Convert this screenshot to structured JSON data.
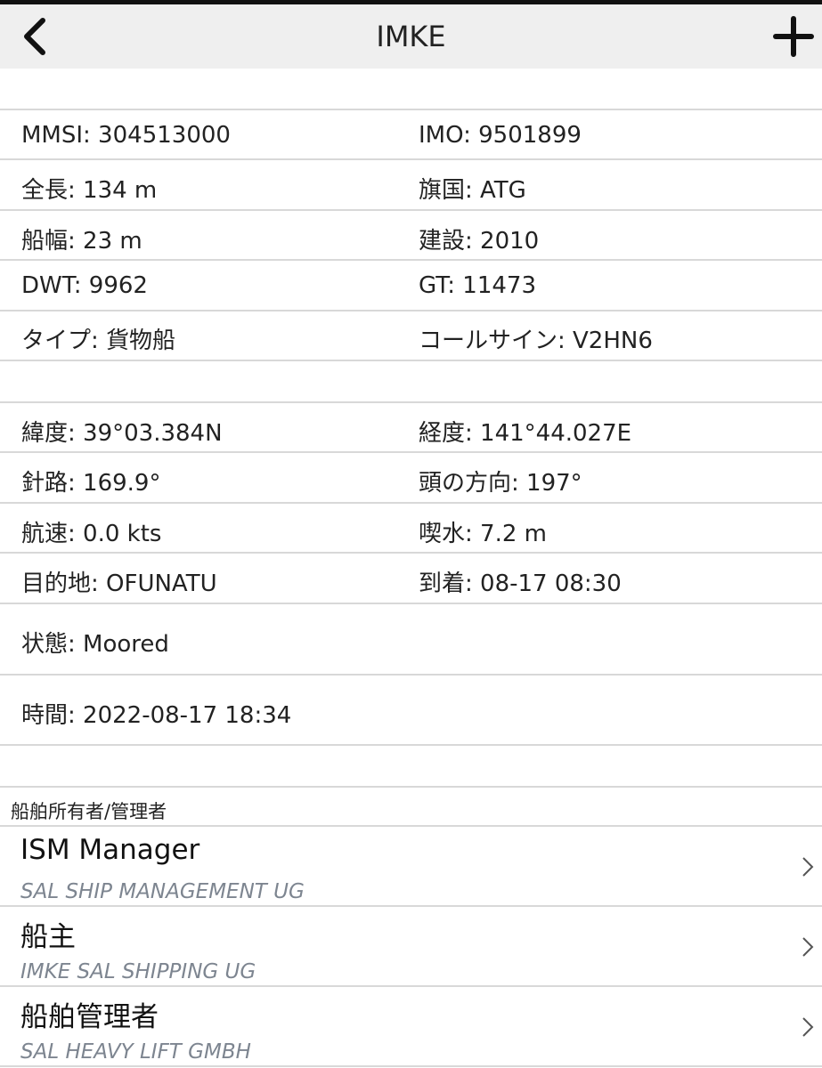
{
  "header": {
    "title": "IMKE",
    "back_icon": "chevron-left-icon",
    "add_icon": "plus-icon"
  },
  "vessel_info": {
    "rows": [
      {
        "left": "MMSI: 304513000",
        "right": "IMO: 9501899"
      },
      {
        "left": "全長: 134 m",
        "right": "旗国: ATG"
      },
      {
        "left": "船幅: 23 m",
        "right": "建設: 2010"
      },
      {
        "left": "DWT: 9962",
        "right": "GT: 11473"
      },
      {
        "left": "タイプ: 貨物船",
        "right": "コールサイン: V2HN6"
      }
    ]
  },
  "voyage_info": {
    "rows": [
      {
        "left": "緯度: 39°03.384N",
        "right": "経度: 141°44.027E"
      },
      {
        "left": "針路: 169.9°",
        "right": "頭の方向: 197°"
      },
      {
        "left": "航速: 0.0 kts",
        "right": "喫水: 7.2 m"
      },
      {
        "left": "目的地: OFUNATU",
        "right": "到着: 08-17 08:30"
      }
    ],
    "status": "状態: Moored",
    "time": "時間: 2022-08-17 18:34"
  },
  "owners": {
    "caption": "船舶所有者/管理者",
    "items": [
      {
        "title": "ISM Manager",
        "subtitle": "SAL SHIP MANAGEMENT UG"
      },
      {
        "title": "船主",
        "subtitle": "IMKE SAL SHIPPING UG"
      },
      {
        "title": "船舶管理者",
        "subtitle": "SAL HEAVY LIFT GMBH"
      }
    ],
    "chevron_icon": "chevron-right-icon"
  },
  "colors": {
    "header_bg": "#efefef",
    "divider": "#d8d8d8",
    "subtitle": "#7d8590",
    "text": "#222222"
  }
}
